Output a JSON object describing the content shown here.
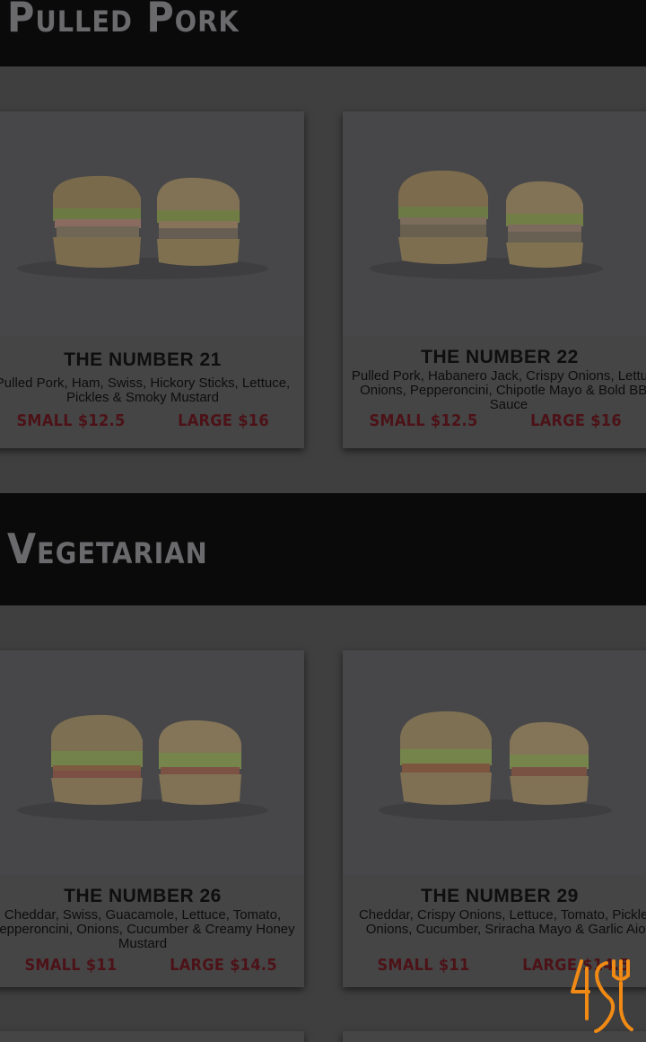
{
  "sections": [
    {
      "title": "Pulled Pork"
    },
    {
      "title": "Vegetarian"
    }
  ],
  "cards": [
    {
      "name": "THE NUMBER 21",
      "desc": "Pulled Pork, Ham, Swiss, Hickory Sticks, Lettuce, Pickles & Smoky Mustard",
      "small": "SMALL $12.5",
      "large": "LARGE $16"
    },
    {
      "name": "THE NUMBER 22",
      "desc": "Pulled Pork, Habanero Jack, Crispy Onions, Lettuce, Onions, Pepperoncini, Chipotle Mayo & Bold BBQ Sauce",
      "small": "SMALL $12.5",
      "large": "LARGE $16"
    },
    {
      "name": "THE NUMBER 26",
      "desc": "Cheddar, Swiss, Guacamole, Lettuce, Tomato, Pepperoncini, Onions, Cucumber & Creamy Honey Mustard",
      "small": "SMALL $11",
      "large": "LARGE $14.5"
    },
    {
      "name": "THE NUMBER 29",
      "desc": "Cheddar, Crispy Onions, Lettuce, Tomato, Pickles, Onions, Cucumber, Sriracha Mayo & Garlic Aioli",
      "small": "SMALL $11",
      "large": "LARGE $14.5"
    }
  ],
  "logo": {
    "icon": "fork-logo-icon",
    "color": "#f08a14"
  }
}
